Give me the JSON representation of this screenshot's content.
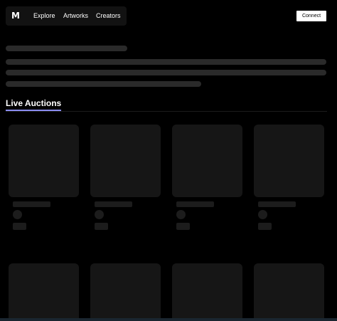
{
  "header": {
    "logo": "M",
    "nav": [
      "Explore",
      "Artworks",
      "Creators"
    ],
    "connect_label": "Connect"
  },
  "section": {
    "title": "Live Auctions",
    "accent_color": "#8a8cf0"
  },
  "colors": {
    "background": "#000000",
    "skeleton": "#2a2a2a",
    "card": "#161616"
  },
  "icons": [
    "logo-mark"
  ]
}
